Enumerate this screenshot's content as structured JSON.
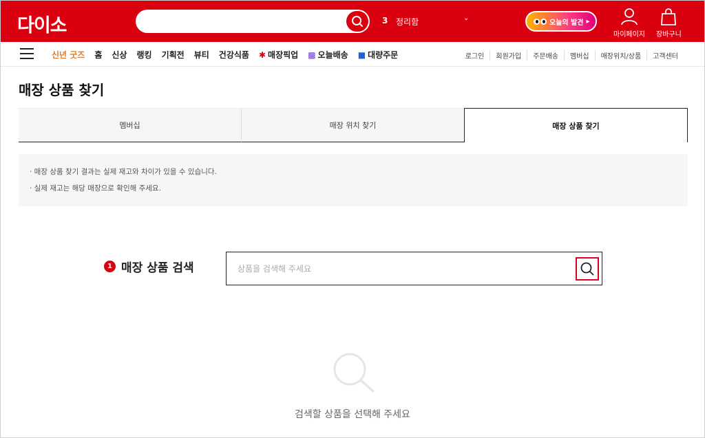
{
  "header": {
    "logo": "다이소",
    "search_placeholder": "",
    "rank_number": "3",
    "rank_keyword": "정리함",
    "today_pill": "오늘의 발견",
    "mypage_label": "마이페이지",
    "cart_label": "장바구니"
  },
  "nav": {
    "items": [
      {
        "label": "신년 굿즈",
        "style": "highlight"
      },
      {
        "label": "홈"
      },
      {
        "label": "신상"
      },
      {
        "label": "랭킹"
      },
      {
        "label": "기획전"
      },
      {
        "label": "뷰티"
      },
      {
        "label": "건강식품"
      },
      {
        "label": "매장픽업"
      },
      {
        "label": "오늘배송"
      },
      {
        "label": "대량주문"
      }
    ],
    "util_links": [
      "로그인",
      "회원가입",
      "주문배송",
      "멤버십",
      "매장위치/상품",
      "고객센터"
    ]
  },
  "page": {
    "title": "매장 상품 찾기",
    "tabs": [
      {
        "label": "멤버십",
        "active": false
      },
      {
        "label": "매장 위치 찾기",
        "active": false
      },
      {
        "label": "매장 상품 찾기",
        "active": true
      }
    ],
    "notices": [
      "· 매장 상품 찾기 결과는 실제 재고와 차이가 있을 수 있습니다.",
      "· 실제 재고는 해당 매장으로 확인해 주세요."
    ],
    "step_number": "1",
    "search_label": "매장 상품 검색",
    "search_placeholder": "상품을 검색해 주세요",
    "empty_message": "검색할 상품을 선택해 주세요"
  },
  "colors": {
    "brand_red": "#da0010",
    "highlight_box": "#e0001b"
  }
}
